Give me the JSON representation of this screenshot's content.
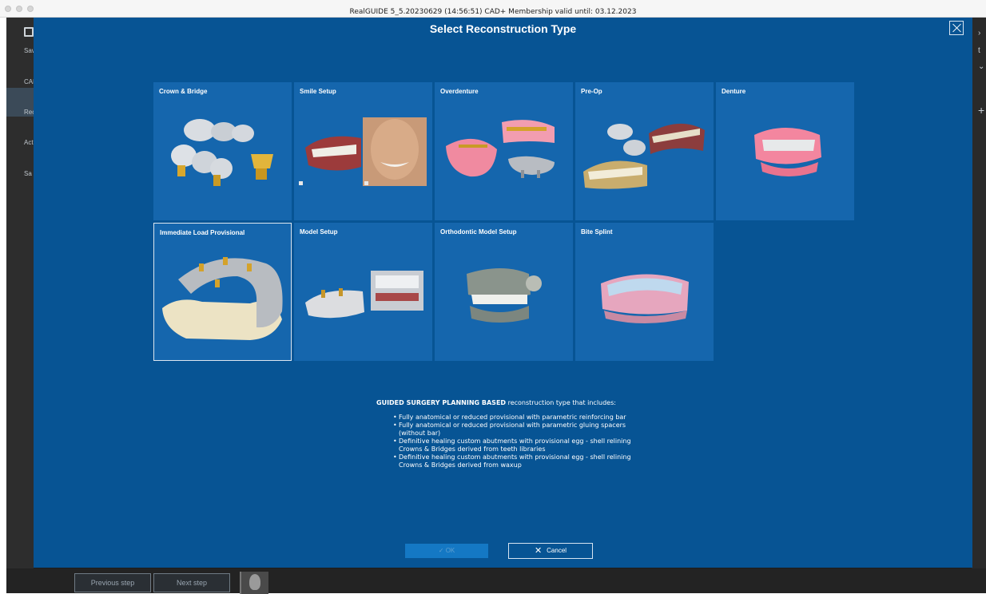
{
  "window": {
    "title": "RealGUIDE 5_5.20230629 (14:56:51)  CAD+ Membership valid until: 03.12.2023"
  },
  "app_sidebar": {
    "items": [
      "Sav",
      "CAD",
      "Rec",
      "Acti",
      "Sa"
    ]
  },
  "app_right_strip": {
    "items": [
      "t"
    ]
  },
  "bottom_bar": {
    "previous_label": "Previous step",
    "next_label": "Next step"
  },
  "dialog": {
    "title": "Select Reconstruction Type",
    "tiles": [
      {
        "label": "Crown & Bridge",
        "icon": "crown-bridge-image"
      },
      {
        "label": "Smile Setup",
        "icon": "smile-setup-image"
      },
      {
        "label": "Overdenture",
        "icon": "overdenture-image"
      },
      {
        "label": "Pre-Op",
        "icon": "pre-op-image"
      },
      {
        "label": "Denture",
        "icon": "denture-image"
      },
      {
        "label": "Immediate Load Provisional",
        "icon": "immediate-load-image",
        "selected": true
      },
      {
        "label": "Model Setup",
        "icon": "model-setup-image"
      },
      {
        "label": "Orthodontic Model Setup",
        "icon": "orthodontic-model-image"
      },
      {
        "label": "Bite Splint",
        "icon": "bite-splint-image"
      }
    ],
    "description": {
      "heading_bold": "GUIDED SURGERY PLANNING BASED",
      "heading_rest": " reconstruction type that includes:",
      "bullets": [
        "Fully anatomical or reduced provisional with parametric reinforcing bar",
        "Fully anatomical or reduced provisional with parametric gluing spacers (without bar)",
        "Definitive healing custom abutments with provisional egg - shell relining Crowns & Bridges derived from teeth libraries",
        "Definitive healing custom abutments with provisional egg - shell relining Crowns & Bridges derived from waxup"
      ]
    },
    "ok_label": "OK",
    "cancel_label": "Cancel"
  },
  "colors": {
    "dialog_bg": "#075494",
    "tile_bg": "#1566ad",
    "accent": "#1478c4"
  }
}
